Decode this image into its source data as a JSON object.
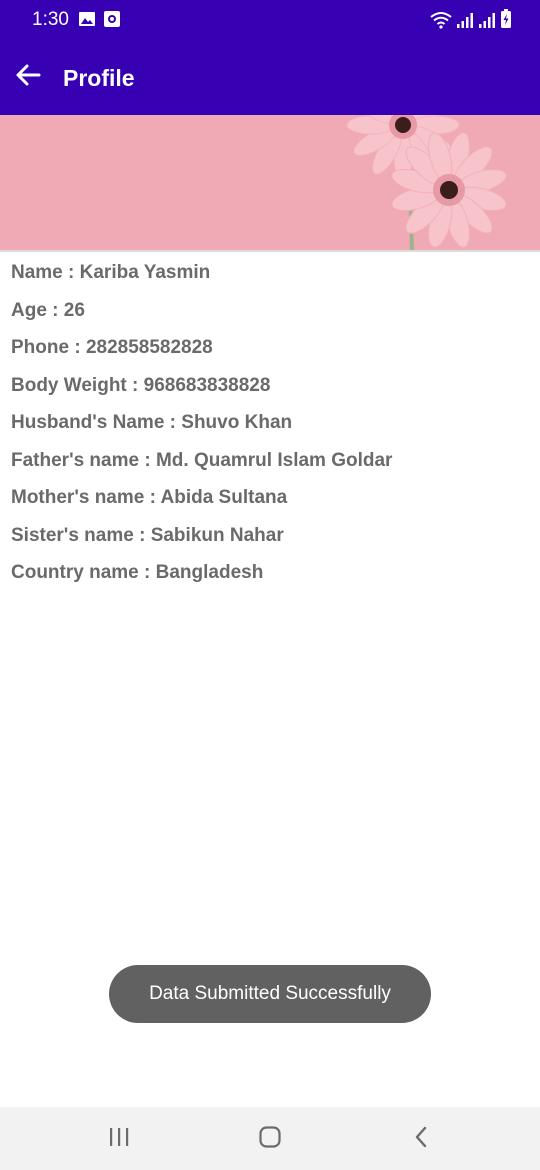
{
  "status_bar": {
    "time": "1:30",
    "background_color": "#3700b3",
    "icons": [
      "image-notification-icon",
      "screenshot-notification-icon",
      "wifi-icon",
      "signal-icon",
      "signal-icon",
      "battery-charging-icon"
    ]
  },
  "app_bar": {
    "title": "Profile",
    "back_icon": "arrow-left-icon",
    "color": "#3700b3"
  },
  "banner": {
    "description_icon": "pink-gerbera-flowers-banner",
    "background_color": "#efaab5"
  },
  "profile": {
    "rows": [
      {
        "text": "Name  :  Kariba Yasmin"
      },
      {
        "text": "Age  : 26"
      },
      {
        "text": "Phone  : 282858582828"
      },
      {
        "text": "Body Weight  :  968683838828"
      },
      {
        "text": "Husband's Name  : Shuvo Khan"
      },
      {
        "text": "Father's name  : Md. Quamrul Islam Goldar"
      },
      {
        "text": "Mother's name  : Abida Sultana"
      },
      {
        "text": "Sister's name  : Sabikun Nahar"
      },
      {
        "text": "Country name  : Bangladesh"
      }
    ]
  },
  "toast": {
    "message": "Data Submitted Successfully"
  },
  "nav_bar": {
    "buttons": [
      "recent-apps-icon",
      "home-icon",
      "back-icon"
    ]
  }
}
